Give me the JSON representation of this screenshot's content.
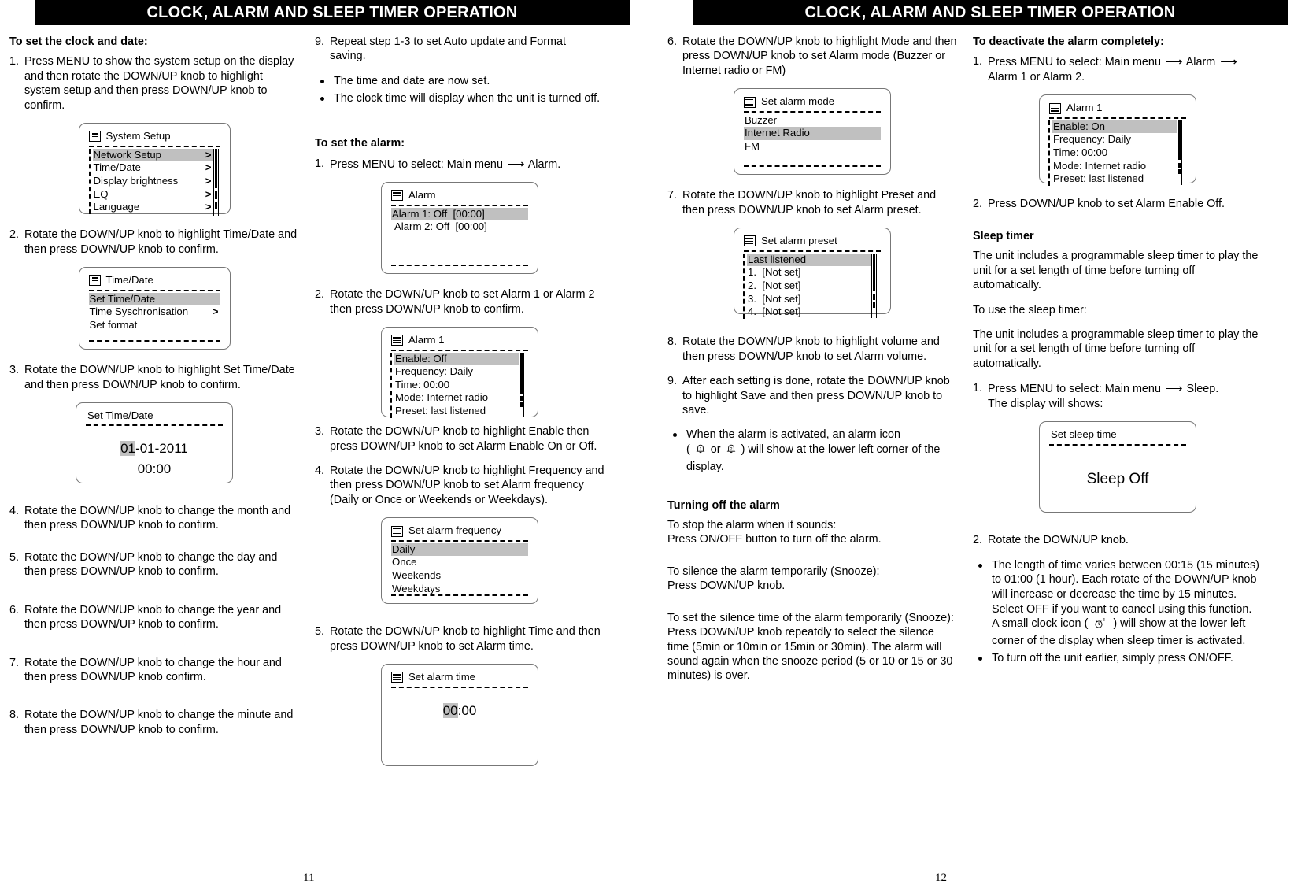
{
  "pages": {
    "left": {
      "header": "CLOCK, ALARM AND SLEEP TIMER OPERATION",
      "page_number": "11"
    },
    "right": {
      "header": "CLOCK, ALARM AND SLEEP TIMER OPERATION",
      "page_number": "12"
    }
  },
  "col1": {
    "heading": "To set the clock and date:",
    "step1_num": "1.",
    "step1_text": "Press MENU to show the system setup on the display and then rotate the DOWN/UP knob to highlight system setup and then press DOWN/UP knob to confirm.",
    "screen_system_setup": {
      "title": "System Setup",
      "icon": "menu-list-icon",
      "items": [
        {
          "label": "Network Setup",
          "chevron": ">",
          "highlighted": true
        },
        {
          "label": "Time/Date",
          "chevron": ">",
          "highlighted": false
        },
        {
          "label": "Display brightness",
          "chevron": ">",
          "highlighted": false
        },
        {
          "label": "EQ",
          "chevron": ">",
          "highlighted": false
        },
        {
          "label": "Language",
          "chevron": ">",
          "highlighted": false
        }
      ]
    },
    "step2_num": "2.",
    "step2_text": "Rotate the DOWN/UP knob to highlight Time/Date and then press DOWN/UP knob to confirm.",
    "screen_time_date": {
      "title": "Time/Date",
      "icon": "menu-list-icon",
      "items": [
        {
          "label": "Set Time/Date",
          "chevron": "",
          "highlighted": true
        },
        {
          "label": "Time Syschronisation",
          "chevron": ">",
          "highlighted": false
        },
        {
          "label": "Set format",
          "chevron": "",
          "highlighted": false
        }
      ]
    },
    "step3_num": "3.",
    "step3_text": "Rotate the DOWN/UP knob to highlight Set Time/Date and then press DOWN/UP knob to confirm.",
    "screen_set_time_date": {
      "title": "Set Time/Date",
      "date_highlight": "01",
      "date_rest": "-01-2011",
      "time": "00:00"
    },
    "step4_num": "4.",
    "step4_text": "Rotate the DOWN/UP knob to change the month and then press DOWN/UP knob to confirm.",
    "step5_num": "5.",
    "step5_text": "Rotate the DOWN/UP knob to change the day and then press DOWN/UP knob to confirm.",
    "step6_num": "6.",
    "step6_text": "Rotate the DOWN/UP knob to change the year and then press DOWN/UP knob to confirm.",
    "step7_num": "7.",
    "step7_text": "Rotate the DOWN/UP knob to change the hour and then press DOWN/UP knob confirm.",
    "step8_num": "8.",
    "step8_text": "Rotate the DOWN/UP knob to change the minute and then press DOWN/UP knob to confirm."
  },
  "col2": {
    "step9_num": "9.",
    "step9_text": "Repeat step 1-3 to set Auto update and Format saving.",
    "bullets": [
      "The time and date are now set.",
      "The clock time will display when the unit is turned off."
    ],
    "heading_alarm": "To set the alarm:",
    "step1_num": "1.",
    "step1_pre": "Press MENU to select: Main menu",
    "step1_arrow": "⟶",
    "step1_post": "Alarm.",
    "screen_alarm": {
      "title": "Alarm",
      "icon": "menu-list-icon",
      "items": [
        {
          "label": "Alarm 1: Off",
          "value": "[00:00]",
          "highlighted": true
        },
        {
          "label": "Alarm 2: Off",
          "value": "[00:00]",
          "highlighted": false
        }
      ]
    },
    "step2_num": "2.",
    "step2_text": "Rotate the DOWN/UP knob to set Alarm 1 or Alarm 2 then press DOWN/UP knob to confirm.",
    "screen_alarm1": {
      "title": "Alarm 1",
      "icon": "menu-list-icon",
      "items": [
        {
          "label": "Enable: Off",
          "highlighted": true
        },
        {
          "label": "Frequency: Daily",
          "highlighted": false
        },
        {
          "label": "Time: 00:00",
          "highlighted": false
        },
        {
          "label": "Mode: Internet radio",
          "highlighted": false
        },
        {
          "label": "Preset: last listened",
          "highlighted": false
        }
      ]
    },
    "step3_num": "3.",
    "step3_text": "Rotate the DOWN/UP knob to highlight Enable then press DOWN/UP knob to set Alarm Enable On or Off.",
    "step4_num": "4.",
    "step4_text": "Rotate the DOWN/UP knob to highlight Frequency and then press DOWN/UP knob to set Alarm frequency (Daily or Once or Weekends or Weekdays).",
    "screen_alarm_frequency": {
      "title": "Set alarm frequency",
      "icon": "menu-list-icon",
      "items": [
        {
          "label": "Daily",
          "highlighted": true
        },
        {
          "label": "Once",
          "highlighted": false
        },
        {
          "label": "Weekends",
          "highlighted": false
        },
        {
          "label": "Weekdays",
          "highlighted": false
        }
      ]
    },
    "step5_num": "5.",
    "step5_text": "Rotate the DOWN/UP knob to highlight Time and then press DOWN/UP knob to set Alarm time.",
    "screen_alarm_time": {
      "title": "Set alarm time",
      "icon": "menu-list-icon",
      "value_highlight": "00",
      "value_rest": ":00"
    }
  },
  "col3": {
    "step6_num": "6.",
    "step6_text": "Rotate the DOWN/UP knob to highlight Mode and then press DOWN/UP knob to set Alarm mode (Buzzer or Internet radio or FM)",
    "screen_alarm_mode": {
      "title": "Set alarm mode",
      "icon": "menu-list-icon",
      "items": [
        {
          "label": "Buzzer",
          "highlighted": false
        },
        {
          "label": "Internet Radio",
          "highlighted": true
        },
        {
          "label": "FM",
          "highlighted": false
        }
      ]
    },
    "step7_num": "7.",
    "step7_text": "Rotate the DOWN/UP knob to highlight Preset and then press DOWN/UP knob to set Alarm preset.",
    "screen_alarm_preset": {
      "title": "Set alarm preset",
      "icon": "menu-list-icon",
      "items": [
        {
          "label": "Last listened",
          "highlighted": true
        },
        {
          "label": "1.",
          "value": "[Not set]",
          "highlighted": false
        },
        {
          "label": "2.",
          "value": "[Not set]",
          "highlighted": false
        },
        {
          "label": "3.",
          "value": "[Not set]",
          "highlighted": false
        },
        {
          "label": "4.",
          "value": "[Not set]",
          "highlighted": false
        }
      ]
    },
    "step8_num": "8.",
    "step8_text": "Rotate the DOWN/UP knob to highlight volume and then press DOWN/UP knob to set Alarm volume.",
    "step9_num": "9.",
    "step9_text": "After each setting is done, rotate the DOWN/UP knob to highlight Save and then press DOWN/UP knob to save.",
    "bullet_alarm_icon_pre": "When the alarm is activated, an alarm icon",
    "bullet_alarm_icon_open": "(",
    "bullet_alarm_icon_or": "or",
    "bullet_alarm_icon_close": ")",
    "bullet_alarm_icon_post": "will show at the lower left corner of the display.",
    "heading_turning_off": "Turning off the alarm",
    "stop_line1": "To stop the alarm when it sounds:",
    "stop_line2": "Press ON/OFF button to turn off the alarm.",
    "snooze_line1": "To silence the alarm temporarily (Snooze):",
    "snooze_line2": "Press DOWN/UP knob.",
    "snooze_set_line1": "To set the silence time of the alarm temporarily (Snooze):",
    "snooze_set_line2": "Press DOWN/UP knob repeatdly to select the silence time (5min or 10min or 15min or 30min). The alarm will sound again when the snooze period (5 or 10 or 15 or 30 minutes) is over."
  },
  "col4": {
    "heading_deactivate": "To deactivate the alarm completely:",
    "step1_num": "1.",
    "step1_pre": "Press MENU to select: Main menu",
    "step1_arrow": "⟶",
    "step1_mid": "Alarm",
    "step1_arrow2": "⟶",
    "step1_post": "Alarm 1 or Alarm 2.",
    "screen_alarm1": {
      "title": "Alarm 1",
      "icon": "menu-list-icon",
      "items": [
        {
          "label": "Enable: On",
          "highlighted": true
        },
        {
          "label": "Frequency: Daily",
          "highlighted": false
        },
        {
          "label": "Time: 00:00",
          "highlighted": false
        },
        {
          "label": "Mode: Internet radio",
          "highlighted": false
        },
        {
          "label": "Preset: last listened",
          "highlighted": false
        }
      ]
    },
    "step2_num": "2.",
    "step2_text": "Press DOWN/UP knob to set Alarm Enable Off.",
    "heading_sleep_timer": "Sleep timer",
    "sleep_p1": "The unit includes a programmable sleep timer to play the unit for a set length of time before turning off automatically.",
    "sleep_p2": "To use the sleep timer:",
    "sleep_p3": "The unit includes a programmable sleep timer to play the unit for a set length of time before turning off automatically.",
    "sleep_step1_num": "1.",
    "sleep_step1_pre": "Press MENU to select: Main menu",
    "sleep_step1_arrow": "⟶",
    "sleep_step1_post": "Sleep.",
    "sleep_step1_line2": "The display will shows:",
    "screen_sleep": {
      "title": "Set sleep time",
      "value": "Sleep Off"
    },
    "sleep_step2_num": "2.",
    "sleep_step2_text": "Rotate the DOWN/UP knob.",
    "sleep_bullet1_a": "The length of time varies between 00:15 (15 minutes) to 01:00 (1 hour). Each rotate of the DOWN/UP knob will increase or decrease the time by 15 minutes.",
    "sleep_bullet1_b": "Select OFF if you want to cancel using this function.",
    "sleep_bullet1_c_pre": "A small clock icon (",
    "sleep_bullet1_c_post": ") will show at the lower left corner of the display when sleep timer is activated.",
    "sleep_bullet2": "To turn off the unit earlier, simply press ON/OFF."
  }
}
